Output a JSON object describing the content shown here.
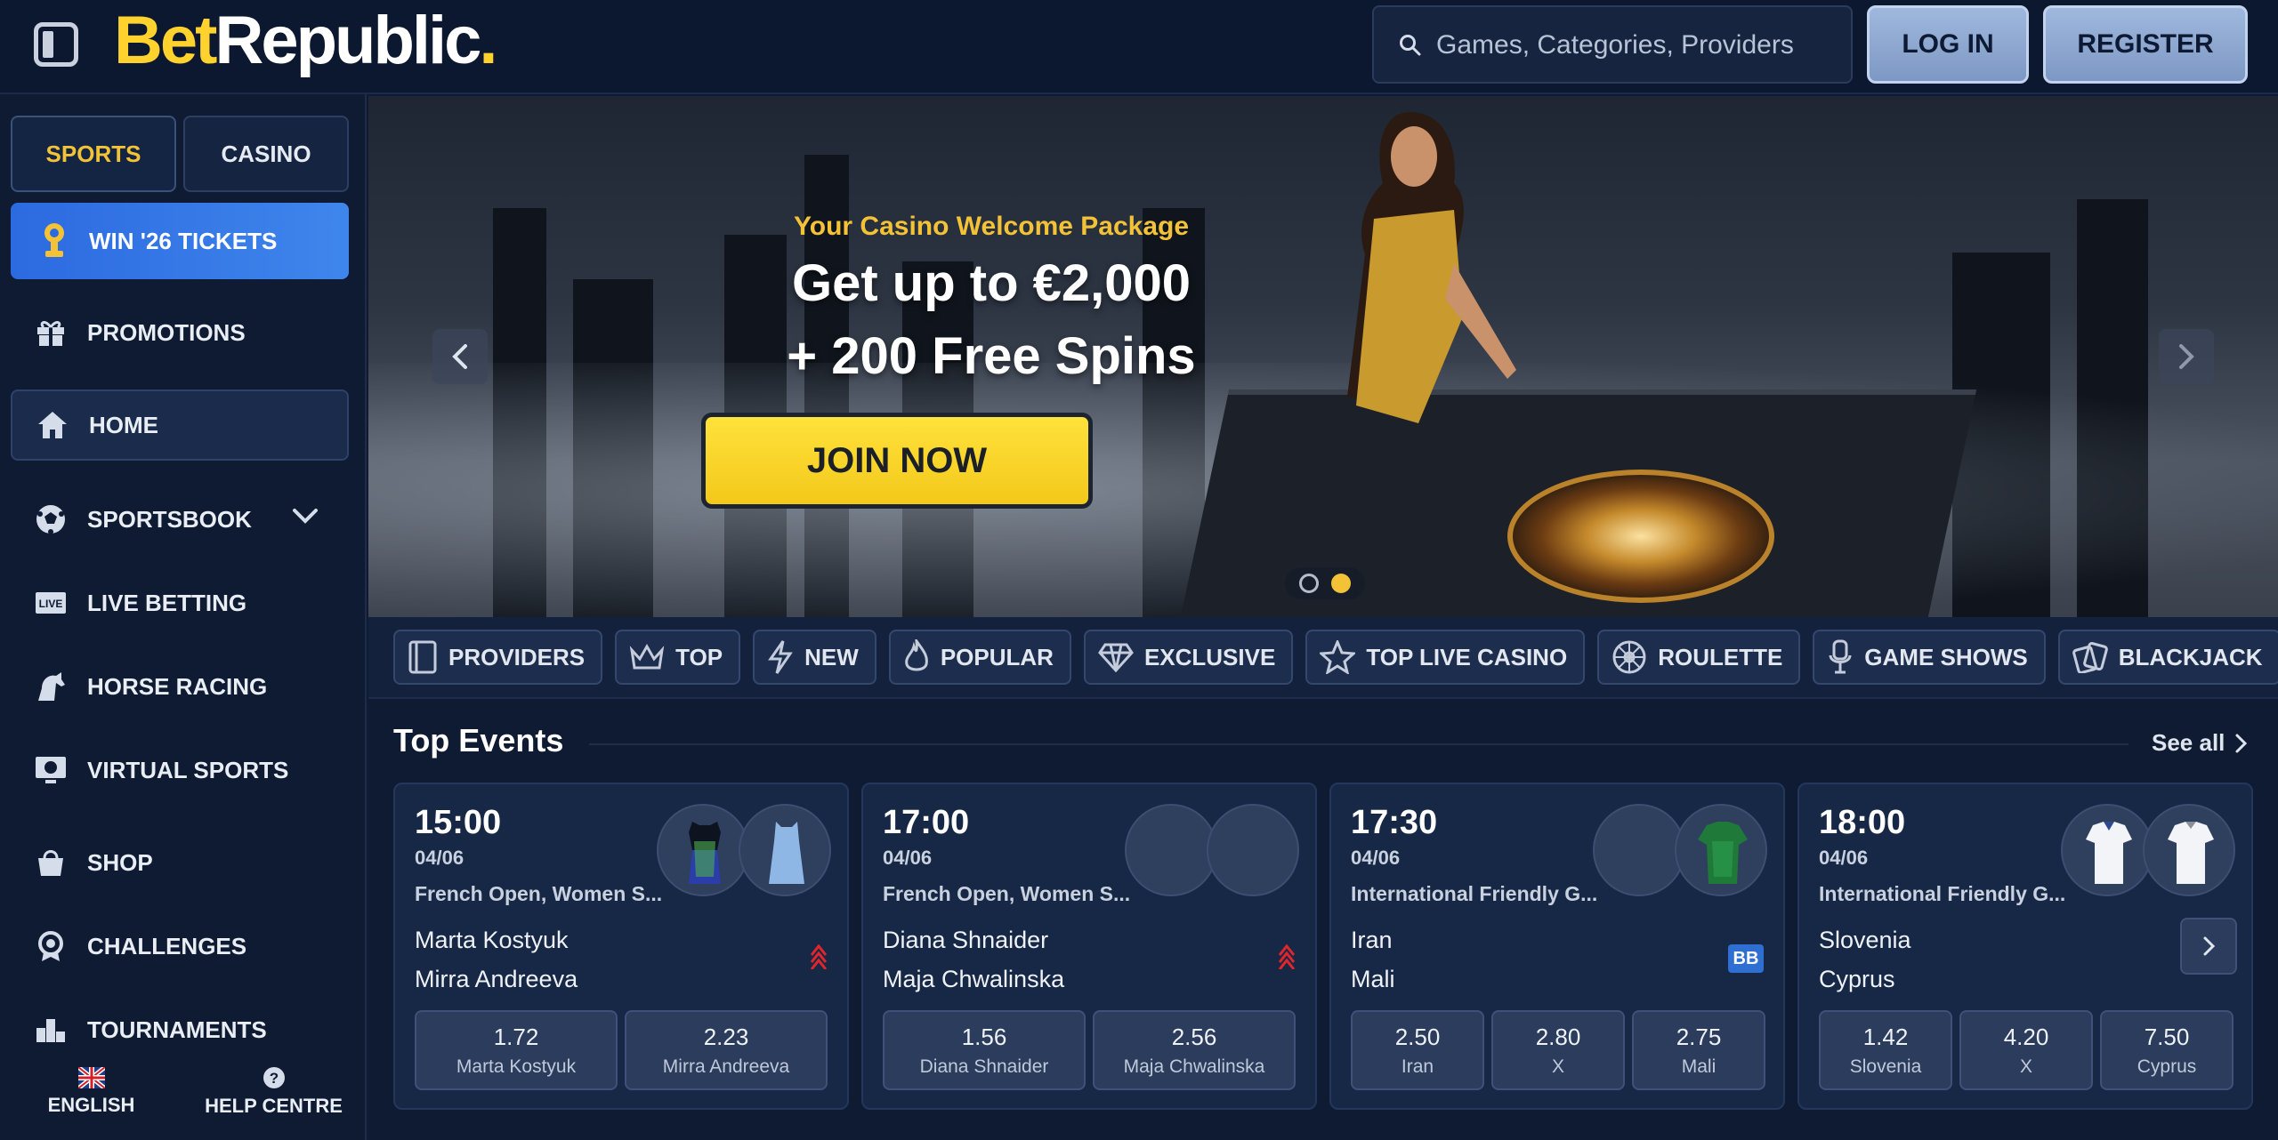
{
  "header": {
    "logo_bet": "Bet",
    "logo_republic": "Republic",
    "logo_dot": ".",
    "search_placeholder": "Games, Categories, Providers",
    "login_label": "LOG IN",
    "register_label": "REGISTER"
  },
  "sidebar": {
    "tabs": [
      {
        "label": "SPORTS",
        "active": true
      },
      {
        "label": "CASINO",
        "active": false
      }
    ],
    "promo": "WIN '26 TICKETS",
    "items": [
      {
        "label": "PROMOTIONS",
        "icon": "gift-icon"
      },
      {
        "label": "HOME",
        "icon": "home-icon",
        "active": true
      },
      {
        "label": "SPORTSBOOK",
        "icon": "soccer-ball-icon",
        "expandable": true
      },
      {
        "label": "LIVE BETTING",
        "icon": "live-icon"
      },
      {
        "label": "HORSE RACING",
        "icon": "horse-icon"
      },
      {
        "label": "VIRTUAL SPORTS",
        "icon": "virtual-sports-icon"
      },
      {
        "label": "SHOP",
        "icon": "shopping-bag-icon"
      },
      {
        "label": "CHALLENGES",
        "icon": "challenges-icon"
      },
      {
        "label": "TOURNAMENTS",
        "icon": "tournaments-icon"
      }
    ],
    "footer": {
      "language": "ENGLISH",
      "help": "HELP CENTRE"
    }
  },
  "hero": {
    "subtitle": "Your Casino Welcome Package",
    "title_line1": "Get up to €2,000",
    "title_line2": "+ 200 Free Spins",
    "cta": "JOIN NOW",
    "slide_count": 2,
    "active_slide": 2
  },
  "categories": [
    {
      "label": "PROVIDERS",
      "icon": "providers-icon"
    },
    {
      "label": "TOP",
      "icon": "crown-icon"
    },
    {
      "label": "NEW",
      "icon": "lightning-icon"
    },
    {
      "label": "POPULAR",
      "icon": "flame-icon"
    },
    {
      "label": "EXCLUSIVE",
      "icon": "diamond-icon"
    },
    {
      "label": "TOP LIVE CASINO",
      "icon": "star-icon"
    },
    {
      "label": "ROULETTE",
      "icon": "roulette-icon"
    },
    {
      "label": "GAME SHOWS",
      "icon": "microphone-icon"
    },
    {
      "label": "BLACKJACK",
      "icon": "cards-icon"
    }
  ],
  "top_events": {
    "title": "Top Events",
    "see_all": "See all",
    "events": [
      {
        "time": "15:00",
        "date": "04/06",
        "competition": "French Open, Women S...",
        "team1": "Marta Kostyuk",
        "team2": "Mirra Andreeva",
        "odds": [
          {
            "value": "1.72",
            "label": "Marta Kostyuk"
          },
          {
            "value": "2.23",
            "label": "Mirra Andreeva"
          }
        ]
      },
      {
        "time": "17:00",
        "date": "04/06",
        "competition": "French Open, Women S...",
        "team1": "Diana Shnaider",
        "team2": "Maja Chwalinska",
        "odds": [
          {
            "value": "1.56",
            "label": "Diana Shnaider"
          },
          {
            "value": "2.56",
            "label": "Maja Chwalinska"
          }
        ]
      },
      {
        "time": "17:30",
        "date": "04/06",
        "competition": "International Friendly G...",
        "team1": "Iran",
        "team2": "Mali",
        "badge": "BB",
        "odds": [
          {
            "value": "2.50",
            "label": "Iran"
          },
          {
            "value": "2.80",
            "label": "X"
          },
          {
            "value": "2.75",
            "label": "Mali"
          }
        ]
      },
      {
        "time": "18:00",
        "date": "04/06",
        "competition": "International Friendly G...",
        "team1": "Slovenia",
        "team2": "Cyprus",
        "odds": [
          {
            "value": "1.42",
            "label": "Slovenia"
          },
          {
            "value": "4.20",
            "label": "X"
          },
          {
            "value": "7.50",
            "label": "Cyprus"
          }
        ]
      }
    ]
  },
  "colors": {
    "accent_yellow": "#f3c236",
    "primary_blue": "#2c6ae0",
    "background": "#0f1b33"
  }
}
